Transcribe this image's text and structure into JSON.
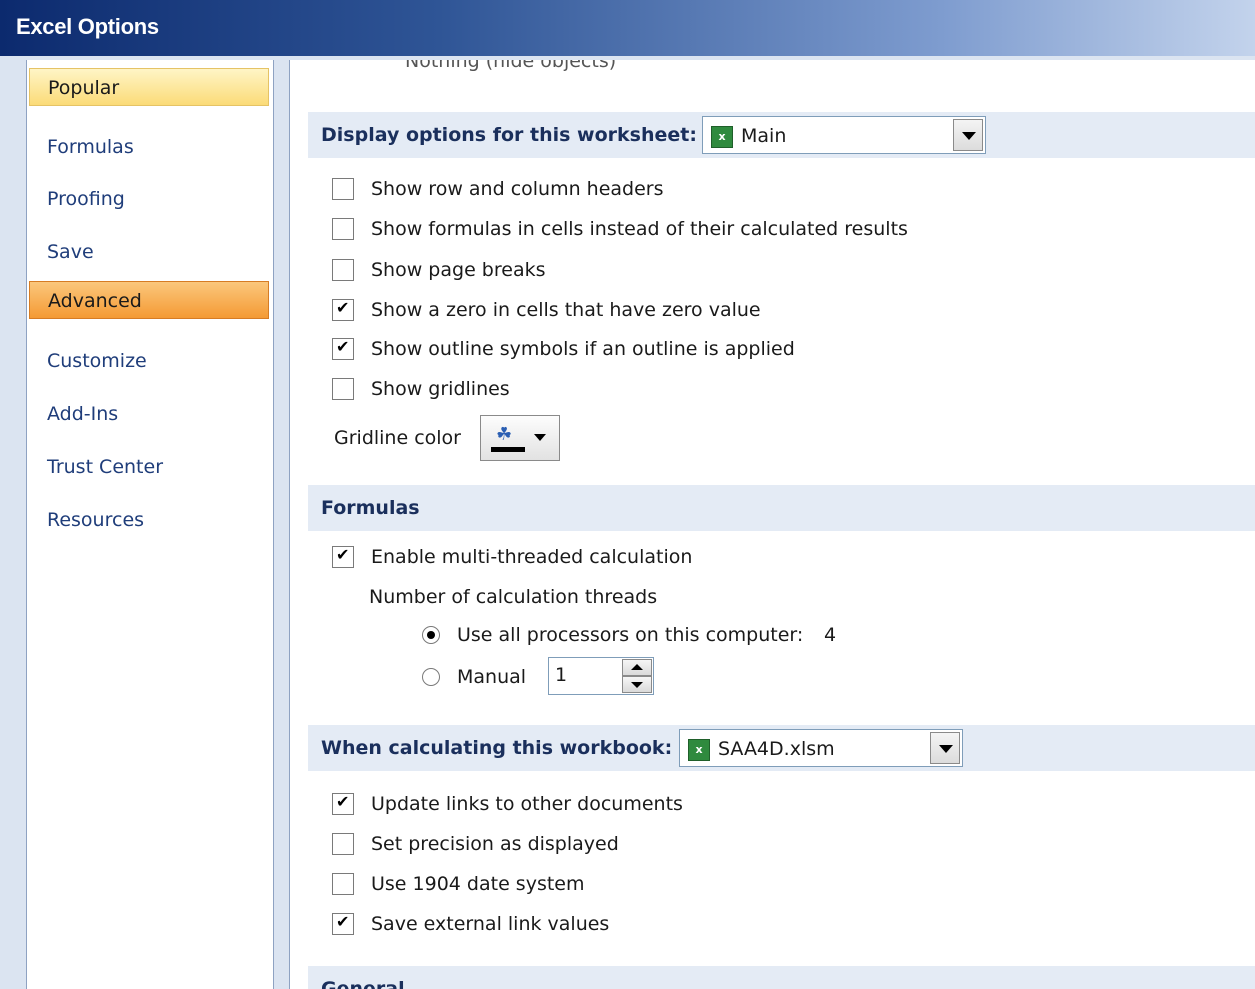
{
  "window": {
    "title": "Excel Options"
  },
  "sidebar": {
    "items": [
      {
        "label": "Popular"
      },
      {
        "label": "Formulas"
      },
      {
        "label": "Proofing"
      },
      {
        "label": "Save"
      },
      {
        "label": "Advanced"
      },
      {
        "label": "Customize"
      },
      {
        "label": "Add-Ins"
      },
      {
        "label": "Trust Center"
      },
      {
        "label": "Resources"
      }
    ]
  },
  "content": {
    "cutoff_text": "Nothing (hide objects)",
    "display_worksheet": {
      "header": "Display options for this worksheet:",
      "sheet_select": {
        "value": "Main",
        "icon": "worksheet-icon"
      },
      "options": [
        {
          "label": "Show row and column headers",
          "checked": false
        },
        {
          "label": "Show formulas in cells instead of their calculated results",
          "checked": false
        },
        {
          "label": "Show page breaks",
          "checked": false
        },
        {
          "label": "Show a zero in cells that have zero value",
          "checked": true
        },
        {
          "label": "Show outline symbols if an outline is applied",
          "checked": true
        },
        {
          "label": "Show gridlines",
          "checked": false
        }
      ],
      "gridline_color_label": "Gridline color"
    },
    "formulas": {
      "header": "Formulas",
      "multithread_label": "Enable multi-threaded calculation",
      "multithread_checked": true,
      "threads_label": "Number of calculation threads",
      "use_all_label": "Use all processors on this computer:",
      "processor_count": "4",
      "manual_label": "Manual",
      "manual_value": "1"
    },
    "workbook": {
      "header": "When calculating this workbook:",
      "workbook_select": {
        "value": "SAA4D.xlsm",
        "icon": "excel-file-icon"
      },
      "options": [
        {
          "label": "Update links to other documents",
          "checked": true
        },
        {
          "label": "Set precision as displayed",
          "checked": false
        },
        {
          "label": "Use 1904 date system",
          "checked": false
        },
        {
          "label": "Save external link values",
          "checked": true
        }
      ]
    },
    "general": {
      "header": "General"
    }
  }
}
